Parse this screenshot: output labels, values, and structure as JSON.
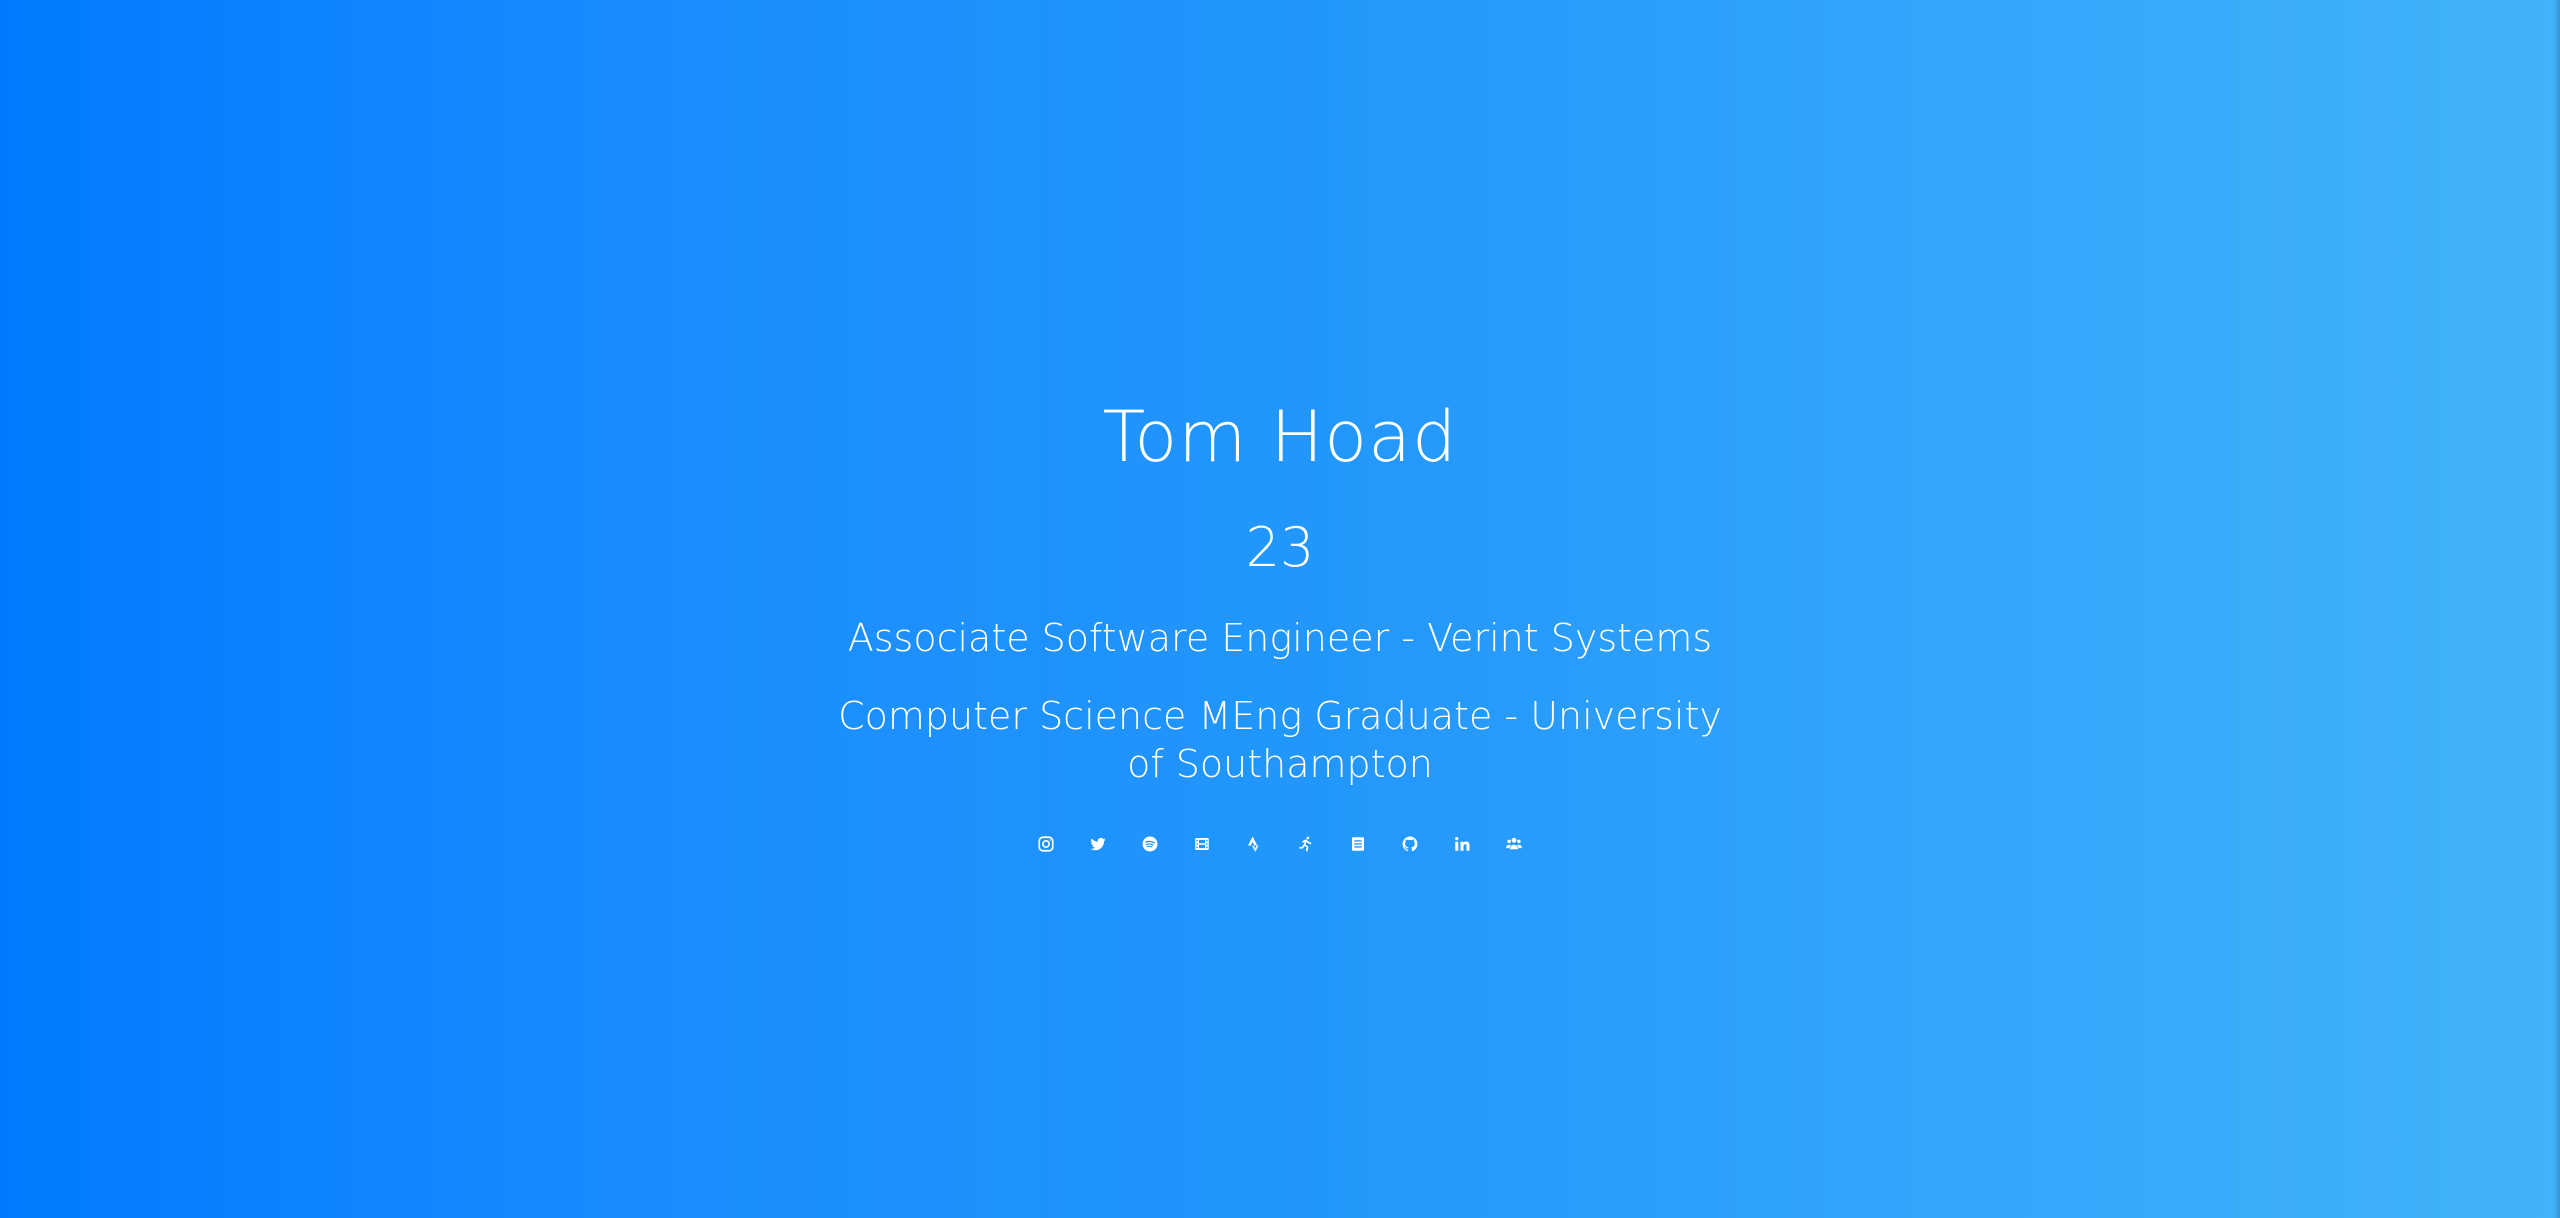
{
  "profile": {
    "name": "Tom Hoad",
    "age": "23",
    "job": "Associate Software Engineer - Verint Systems",
    "education": "Computer Science MEng Graduate - University of Southampton"
  },
  "theme": {
    "gradient_start": "#007bff",
    "gradient_end": "#42b2fa",
    "text_color": "#ffffff"
  },
  "social_links": [
    {
      "icon": "instagram-icon"
    },
    {
      "icon": "twitter-icon"
    },
    {
      "icon": "spotify-icon"
    },
    {
      "icon": "film-icon"
    },
    {
      "icon": "strava-icon"
    },
    {
      "icon": "running-icon"
    },
    {
      "icon": "book-icon"
    },
    {
      "icon": "github-icon"
    },
    {
      "icon": "linkedin-icon"
    },
    {
      "icon": "users-icon"
    }
  ]
}
